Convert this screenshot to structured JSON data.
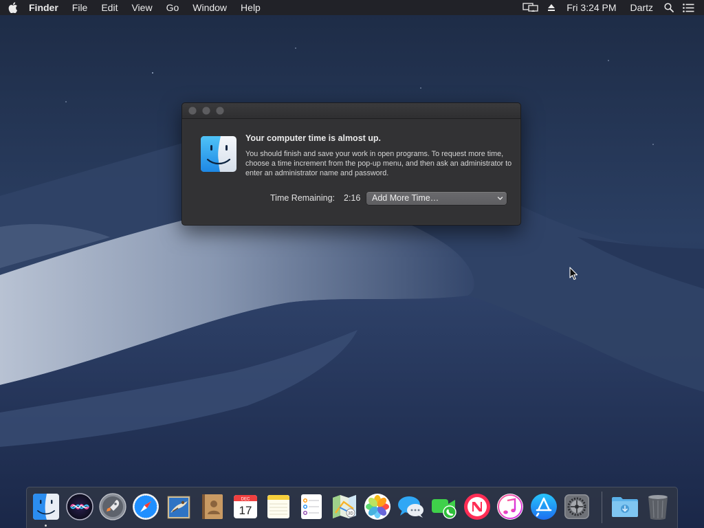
{
  "menubar": {
    "app_name": "Finder",
    "menus": [
      "File",
      "Edit",
      "View",
      "Go",
      "Window",
      "Help"
    ],
    "clock": "Fri 3:24 PM",
    "user": "Dartz",
    "icons": [
      "apple-icon",
      "airplay-display-icon",
      "eject-icon",
      "spotlight-search-icon",
      "notification-center-icon"
    ]
  },
  "alert": {
    "headline": "Your computer time is almost up.",
    "message": "You should finish and save your work in open programs. To request more time, choose a time increment from the pop-up menu, and then ask an administrator to enter an administrator name and password.",
    "time_label": "Time Remaining:",
    "time_value": "2:16",
    "popup_selected": "Add More Time…",
    "icon": "finder-icon"
  },
  "dock": {
    "apps": [
      {
        "icon": "finder-icon",
        "running": true
      },
      {
        "icon": "siri-icon"
      },
      {
        "icon": "launchpad-icon"
      },
      {
        "icon": "safari-icon"
      },
      {
        "icon": "mail-icon"
      },
      {
        "icon": "contacts-icon"
      },
      {
        "icon": "calendar-icon",
        "month": "DEC",
        "day": "17"
      },
      {
        "icon": "notes-icon"
      },
      {
        "icon": "reminders-icon"
      },
      {
        "icon": "maps-icon"
      },
      {
        "icon": "photos-icon"
      },
      {
        "icon": "messages-icon"
      },
      {
        "icon": "facetime-icon"
      },
      {
        "icon": "news-icon"
      },
      {
        "icon": "itunes-icon"
      },
      {
        "icon": "app-store-icon"
      },
      {
        "icon": "system-preferences-icon"
      }
    ],
    "extras": [
      {
        "icon": "downloads-folder-icon"
      },
      {
        "icon": "trash-icon"
      }
    ]
  },
  "colors": {
    "menubar_bg": "#222226",
    "alert_bg": "#323234",
    "popup_bg": "#636366",
    "dock_bg": "#323744"
  }
}
